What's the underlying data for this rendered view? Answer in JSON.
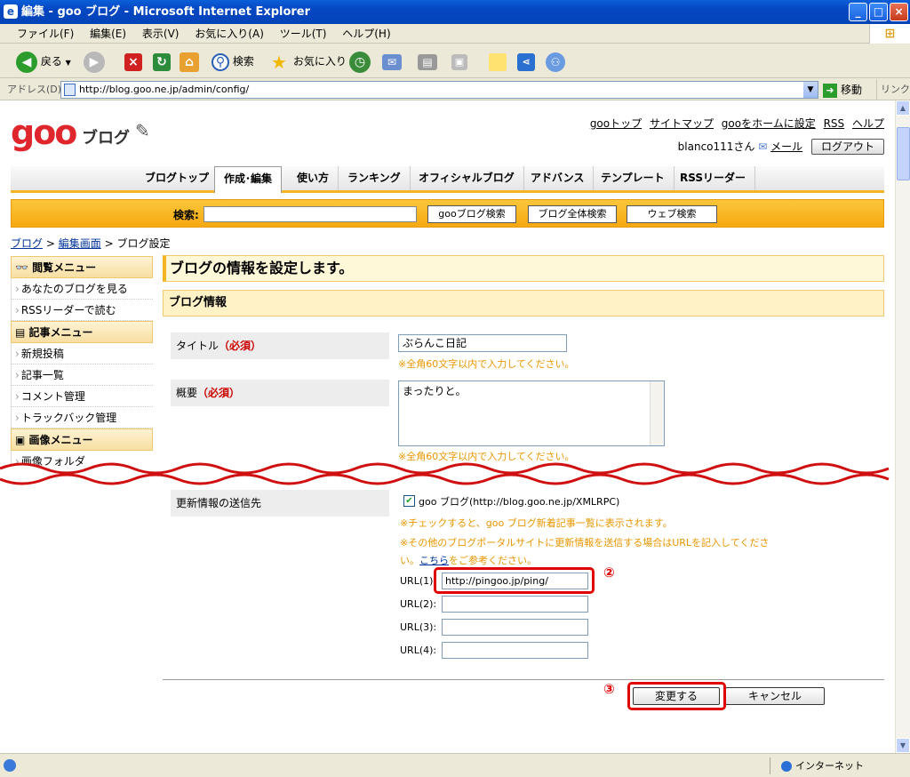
{
  "window": {
    "title": "編集 - goo ブログ - Microsoft Internet Explorer",
    "minimize": "_",
    "maximize": "□",
    "close": "×"
  },
  "menubar": [
    "ファイル(F)",
    "編集(E)",
    "表示(V)",
    "お気に入り(A)",
    "ツール(T)",
    "ヘルプ(H)"
  ],
  "toolbar": {
    "back": "戻る",
    "search": "検索",
    "favorites": "お気に入り"
  },
  "address": {
    "label": "アドレス(D)",
    "url": "http://blog.goo.ne.jp/admin/config/",
    "go": "移動",
    "links": "リンク"
  },
  "header": {
    "logo_goo": "goo",
    "logo_blog": "ブログ",
    "links": [
      "gooトップ",
      "サイトマップ",
      "gooをホームに設定",
      "RSS",
      "ヘルプ"
    ],
    "user": "blanco111さん",
    "mail": "メール",
    "logout": "ログアウト"
  },
  "nav": {
    "tabs": [
      "ブログトップ",
      "作成･編集",
      "使い方",
      "ランキング",
      "オフィシャルブログ",
      "アドバンス",
      "テンプレート",
      "RSSリーダー"
    ],
    "active": "作成･編集"
  },
  "search": {
    "label": "検索:",
    "value": "",
    "buttons": [
      "gooブログ検索",
      "ブログ全体検索",
      "ウェブ検索"
    ]
  },
  "breadcrumb": {
    "items": [
      "ブログ",
      "編集画面"
    ],
    "sep": ">",
    "current": "ブログ設定"
  },
  "sidebar": {
    "sections": [
      {
        "title": "閲覧メニュー",
        "items": [
          "あなたのブログを見る",
          "RSSリーダーで読む"
        ]
      },
      {
        "title": "記事メニュー",
        "items": [
          "新規投稿",
          "記事一覧",
          "コメント管理",
          "トラックバック管理"
        ]
      },
      {
        "title": "画像メニュー",
        "items": [
          "画像フォルダ"
        ]
      }
    ]
  },
  "main": {
    "heading": "ブログの情報を設定します。",
    "subheading": "ブログ情報",
    "title_label": "タイトル",
    "required": "（必須）",
    "title_value": "ぶらんこ日記",
    "title_note": "※全角60文字以内で入力してください。",
    "summary_label": "概要",
    "summary_value": "まったりと。",
    "summary_note": "※全角60文字以内で入力してください。",
    "ping_label": "更新情報の送信先",
    "ping_checkbox": "goo ブログ(http://blog.goo.ne.jp/XMLRPC)",
    "ping_checked": true,
    "ping_note1": "※チェックすると、goo ブログ新着記事一覧に表示されます。",
    "ping_note2a": "※その他のブログポータルサイトに更新情報を送信する場合はURLを記入してくださ",
    "ping_note2b_pre": "い。",
    "ping_note2b_link": "こちら",
    "ping_note2b_post": "をご参考ください。",
    "urls": [
      {
        "label": "URL(1):",
        "value": "http://pingoo.jp/ping/"
      },
      {
        "label": "URL(2):",
        "value": ""
      },
      {
        "label": "URL(3):",
        "value": ""
      },
      {
        "label": "URL(4):",
        "value": ""
      }
    ],
    "marker2": "②",
    "marker3": "③",
    "submit": "変更する",
    "cancel": "キャンセル"
  },
  "status": {
    "zone": "インターネット"
  }
}
